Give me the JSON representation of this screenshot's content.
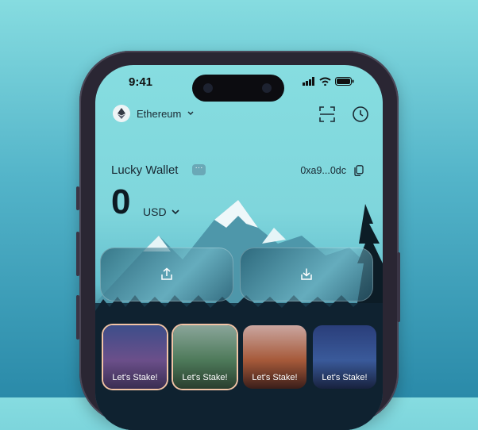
{
  "status_bar": {
    "time": "9:41"
  },
  "network": {
    "label": "Ethereum",
    "icon": "ethereum-icon"
  },
  "header_icons": [
    "scan-icon",
    "history-icon"
  ],
  "wallet": {
    "name": "Lucky Wallet",
    "address": "0xa9...0dc",
    "balance": "0",
    "currency": "USD"
  },
  "actions": [
    {
      "icon": "send-icon"
    },
    {
      "icon": "receive-icon"
    }
  ],
  "cards": [
    {
      "label": "Let's Stake!",
      "selected": true
    },
    {
      "label": "Let's Stake!",
      "selected": true
    },
    {
      "label": "Let's Stake!",
      "selected": false
    },
    {
      "label": "Let's Stake!",
      "selected": false
    }
  ],
  "colors": {
    "background": "#53b4c9",
    "phone_frame": "#2a2633",
    "card_border": "#f2c4a6"
  }
}
